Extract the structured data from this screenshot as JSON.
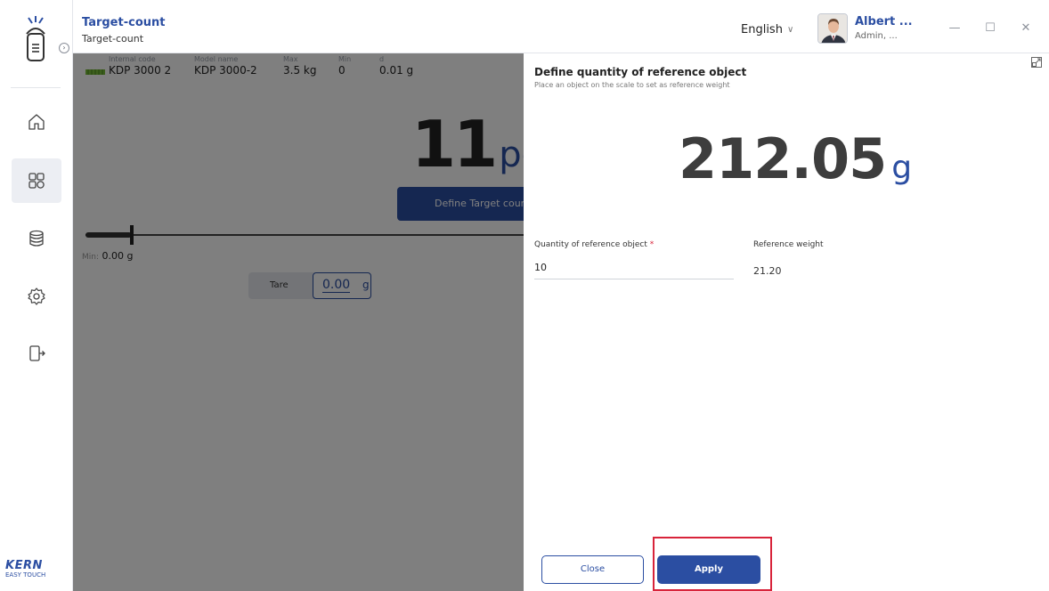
{
  "header": {
    "title": "Target-count",
    "subtitle": "Target-count",
    "language": "English",
    "user_name": "Albert ...",
    "user_role": "Admin, ..."
  },
  "sidebar": {
    "items": [
      {
        "icon": "home-icon"
      },
      {
        "icon": "applications-icon",
        "active": true
      },
      {
        "icon": "database-icon"
      },
      {
        "icon": "settings-icon"
      },
      {
        "icon": "logout-icon"
      }
    ],
    "brand": "KERN",
    "brand_sub": "EASY TOUCH"
  },
  "scale_info": {
    "internal_code_label": "Internal code",
    "internal_code": "KDP 3000 2",
    "model_name_label": "Model name",
    "model_name": "KDP 3000-2",
    "max_label": "Max",
    "max": "3.5 kg",
    "min_label": "Min",
    "min": "0",
    "d_label": "d",
    "d": "0.01 g"
  },
  "main": {
    "count_value": "11",
    "count_unit": "pcs",
    "define_button": "Define Target count",
    "min_label": "Min:",
    "min_value": "0.00 g",
    "tare_label": "Tare",
    "tare_value": "0.00",
    "tare_unit": "g"
  },
  "panel": {
    "title": "Define quantity of reference object",
    "subtitle": "Place an object on the  scale to set as reference weight",
    "reading_value": "212.05",
    "reading_unit": "g",
    "quantity_label": "Quantity of reference object",
    "quantity_required": "*",
    "quantity_value": "10",
    "reference_weight_label": "Reference weight",
    "reference_weight_value": "21.20",
    "close_button": "Close",
    "apply_button": "Apply"
  },
  "colors": {
    "accent": "#2b4ea2",
    "required": "#d8243b",
    "highlight": "#d8243b",
    "overlay": "rgba(0,0,0,0.5)"
  }
}
